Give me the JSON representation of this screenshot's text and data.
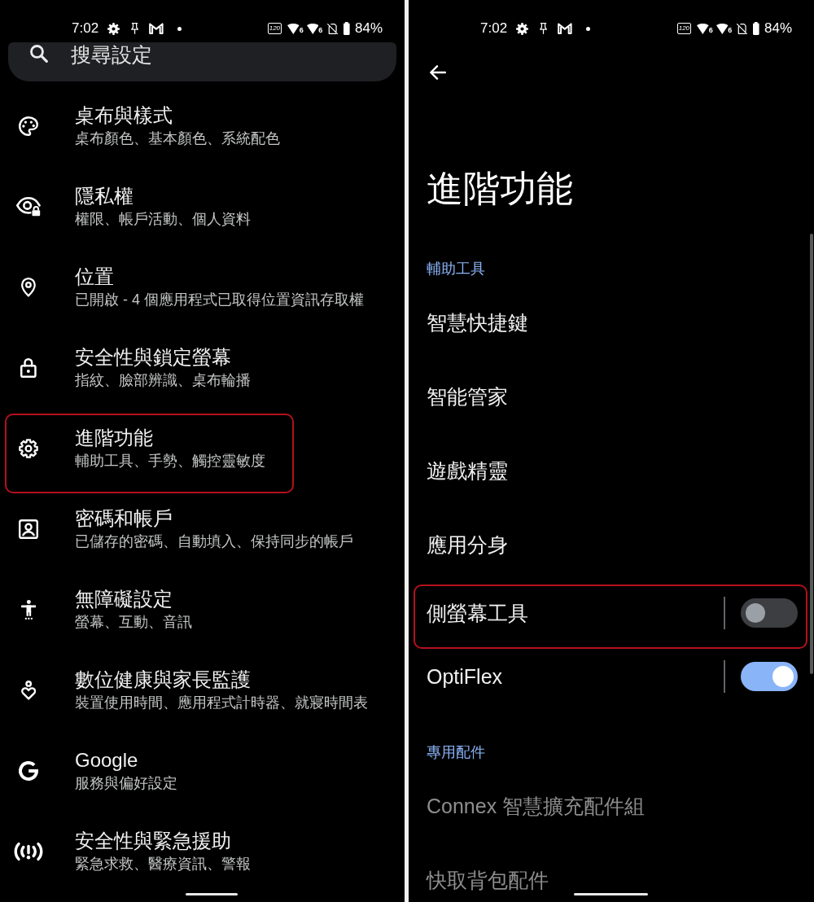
{
  "settings_screen": {
    "status_bar": {
      "time": "7:02",
      "refresh_rate": "120",
      "wifi": [
        {
          "generation": "6"
        },
        {
          "generation": "6"
        }
      ],
      "battery": "84%"
    },
    "search": {
      "placeholder": "搜尋設定"
    },
    "items": [
      {
        "title": "桌布與樣式",
        "subtitle": "桌布顏色、基本顏色、系統配色",
        "highlighted": false
      },
      {
        "title": "隱私權",
        "subtitle": "權限、帳戶活動、個人資料",
        "highlighted": false
      },
      {
        "title": "位置",
        "subtitle": "已開啟 - 4 個應用程式已取得位置資訊存取權",
        "highlighted": false
      },
      {
        "title": "安全性與鎖定螢幕",
        "subtitle": "指紋、臉部辨識、桌布輪播",
        "highlighted": false
      },
      {
        "title": "進階功能",
        "subtitle": "輔助工具、手勢、觸控靈敏度",
        "highlighted": true
      },
      {
        "title": "密碼和帳戶",
        "subtitle": "已儲存的密碼、自動填入、保持同步的帳戶",
        "highlighted": false
      },
      {
        "title": "無障礙設定",
        "subtitle": "螢幕、互動、音訊",
        "highlighted": false
      },
      {
        "title": "數位健康與家長監護",
        "subtitle": "裝置使用時間、應用程式計時器、就寢時間表",
        "highlighted": false
      },
      {
        "title": "Google",
        "subtitle": "服務與偏好設定",
        "highlighted": false
      },
      {
        "title": "安全性與緊急援助",
        "subtitle": "緊急求救、醫療資訊、警報",
        "highlighted": false
      }
    ]
  },
  "advanced_screen": {
    "status_bar": {
      "time": "7:02",
      "refresh_rate": "120",
      "wifi": [
        {
          "generation": "6"
        },
        {
          "generation": "6"
        }
      ],
      "battery": "84%"
    },
    "title": "進階功能",
    "sections": [
      {
        "header": "輔助工具",
        "items": [
          {
            "kind": "link",
            "title": "智慧快捷鍵",
            "disabled": false,
            "highlighted": false
          },
          {
            "kind": "link",
            "title": "智能管家",
            "disabled": false,
            "highlighted": false
          },
          {
            "kind": "link",
            "title": "遊戲精靈",
            "disabled": false,
            "highlighted": false
          },
          {
            "kind": "link",
            "title": "應用分身",
            "disabled": false,
            "highlighted": false
          },
          {
            "kind": "switch",
            "title": "側螢幕工具",
            "on": false,
            "disabled": false,
            "highlighted": true
          },
          {
            "kind": "switch",
            "title": "OptiFlex",
            "on": true,
            "disabled": false,
            "highlighted": false
          }
        ]
      },
      {
        "header": "專用配件",
        "items": [
          {
            "kind": "link",
            "title": "Connex 智慧擴充配件組",
            "disabled": true,
            "highlighted": false
          },
          {
            "kind": "link",
            "title": "快取背包配件",
            "disabled": true,
            "highlighted": false
          }
        ]
      }
    ]
  }
}
